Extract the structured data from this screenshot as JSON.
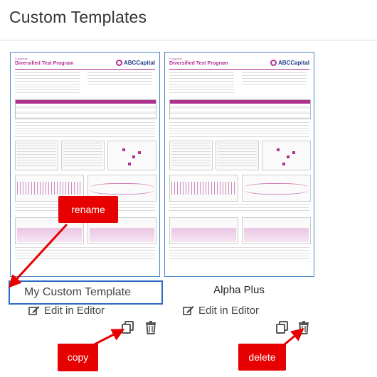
{
  "page": {
    "title": "Custom Templates"
  },
  "templates": [
    {
      "name_value": "My Custom Template",
      "edit_label": "Edit in Editor",
      "thumb": {
        "brand": "Fundpeak",
        "program": "Diversified Test Program",
        "logo": "ABCCapital"
      }
    },
    {
      "name_label": "Alpha Plus",
      "edit_label": "Edit in Editor",
      "thumb": {
        "brand": "Fundpeak",
        "program": "Diversified Test Program",
        "logo": "ABCCapital"
      }
    }
  ],
  "callouts": {
    "rename": "rename",
    "copy": "copy",
    "delete": "delete"
  },
  "icons": [
    "edit-icon",
    "copy-icon",
    "trash-icon"
  ],
  "colors": {
    "accent": "#2b6cc4",
    "callout": "#e60000",
    "thumb_accent": "#b0308e"
  }
}
